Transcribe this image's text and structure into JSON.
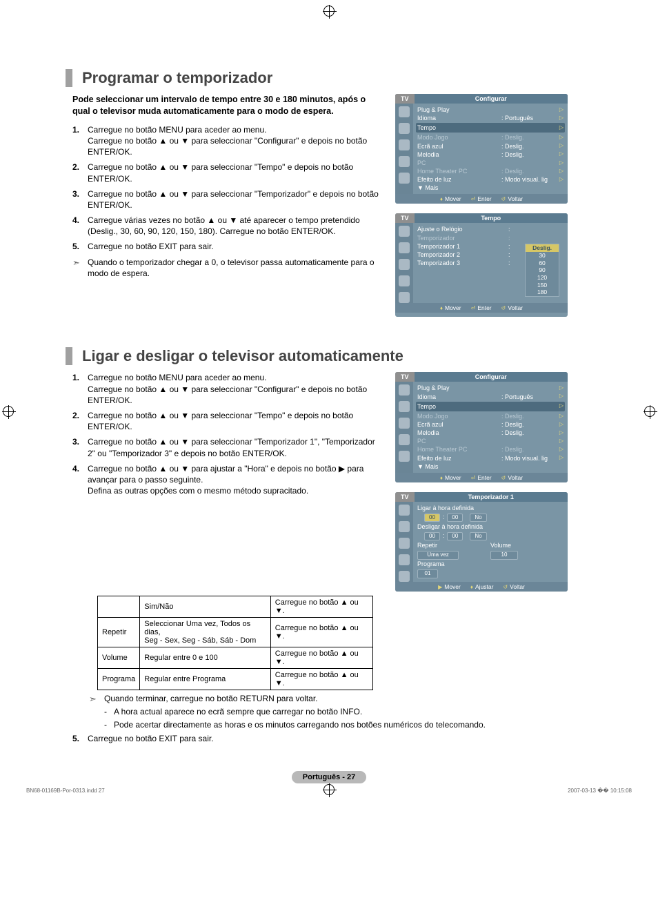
{
  "section1": {
    "title": "Programar o temporizador",
    "intro": "Pode seleccionar um intervalo de tempo entre 30 e 180 minutos, após o qual o televisor muda automaticamente para o modo de espera.",
    "steps": [
      {
        "n": "1.",
        "lines": [
          "Carregue no botão MENU para aceder ao menu.",
          "Carregue no botão ▲ ou ▼ para seleccionar \"Configurar\" e depois no botão ENTER/OK."
        ]
      },
      {
        "n": "2.",
        "lines": [
          "Carregue no botão ▲ ou ▼ para seleccionar \"Tempo\" e depois no botão ENTER/OK."
        ]
      },
      {
        "n": "3.",
        "lines": [
          "Carregue no botão ▲ ou ▼ para seleccionar \"Temporizador\" e depois no botão ENTER/OK."
        ]
      },
      {
        "n": "4.",
        "lines": [
          "Carregue várias vezes no botão ▲ ou ▼ até aparecer o tempo pretendido (Deslig., 30, 60, 90, 120, 150, 180). Carregue no botão ENTER/OK."
        ]
      },
      {
        "n": "5.",
        "lines": [
          "Carregue no botão EXIT para sair."
        ]
      }
    ],
    "note": "Quando o temporizador chegar a 0, o televisor passa automaticamente para o modo de espera."
  },
  "section2": {
    "title": "Ligar e desligar o televisor automaticamente",
    "steps": [
      {
        "n": "1.",
        "lines": [
          "Carregue no botão MENU para aceder ao menu.",
          "Carregue no botão ▲ ou ▼ para seleccionar \"Configurar\" e depois no botão ENTER/OK."
        ]
      },
      {
        "n": "2.",
        "lines": [
          "Carregue no botão ▲ ou ▼ para seleccionar \"Tempo\" e depois no botão ENTER/OK."
        ]
      },
      {
        "n": "3.",
        "lines": [
          "Carregue no botão ▲ ou ▼ para seleccionar \"Temporizador 1\", \"Temporizador 2\" ou \"Temporizador 3\" e depois no botão ENTER/OK."
        ]
      },
      {
        "n": "4.",
        "lines": [
          "Carregue no botão ▲ ou ▼ para ajustar a \"Hora\" e depois no botão ▶ para avançar para o passo seguinte.",
          "Defina as outras opções com o mesmo método supracitado."
        ]
      }
    ],
    "table": {
      "rows": [
        [
          "",
          "Sim/Não",
          "Carregue no botão ▲ ou ▼."
        ],
        [
          "Repetir",
          "Seleccionar Uma vez, Todos os dias,\nSeg - Sex, Seg - Sáb, Sáb - Dom",
          "Carregue no botão ▲ ou ▼."
        ],
        [
          "Volume",
          "Regular entre 0 e 100",
          "Carregue no botão ▲ ou ▼."
        ],
        [
          "Programa",
          "Regular entre Programa",
          "Carregue no botão ▲ ou ▼."
        ]
      ]
    },
    "post_note": "Quando terminar, carregue no botão RETURN para voltar.",
    "post_dashes": [
      "A hora actual aparece no ecrã sempre que carregar no botão INFO.",
      "Pode acertar directamente as horas e os minutos carregando nos botões numéricos do telecomando."
    ],
    "step5": {
      "n": "5.",
      "lines": [
        "Carregue no botão EXIT para sair."
      ]
    }
  },
  "osd_config": {
    "tab": "TV",
    "title": "Configurar",
    "rows": [
      {
        "label": "Plug & Play",
        "value": "",
        "arrow": true
      },
      {
        "label": "Idioma",
        "value": ": Português",
        "arrow": true
      },
      {
        "label": "Tempo",
        "value": "",
        "arrow": true,
        "hl": true
      },
      {
        "label": "Modo Jogo",
        "value": ": Deslig.",
        "dim": true,
        "arrow": true
      },
      {
        "label": "Ecrã azul",
        "value": ": Deslig.",
        "arrow": true
      },
      {
        "label": "Melodia",
        "value": ": Deslig.",
        "arrow": true
      },
      {
        "label": "PC",
        "value": "",
        "dim": true,
        "arrow": true
      },
      {
        "label": "Home Theater PC",
        "value": ": Deslig.",
        "dim": true,
        "arrow": true
      },
      {
        "label": "Efeito de luz",
        "value": ": Modo visual. lig",
        "arrow": true
      },
      {
        "label": "▼ Mais",
        "value": "",
        "arrow": false
      }
    ],
    "footer": [
      "Mover",
      "Enter",
      "Voltar"
    ]
  },
  "osd_tempo": {
    "tab": "TV",
    "title": "Tempo",
    "rows": [
      {
        "label": "Ajuste o Relógio",
        "value": ":"
      },
      {
        "label": "Temporizador",
        "value": ":",
        "hl": true
      },
      {
        "label": "Temporizador 1",
        "value": ":"
      },
      {
        "label": "Temporizador 2",
        "value": ":"
      },
      {
        "label": "Temporizador 3",
        "value": ":"
      }
    ],
    "submenu": [
      "Deslig.",
      "30",
      "60",
      "90",
      "120",
      "150",
      "180"
    ],
    "footer": [
      "Mover",
      "Enter",
      "Voltar"
    ]
  },
  "osd_timer1": {
    "tab": "TV",
    "title": "Temporizador 1",
    "on_label": "Ligar à hora definida",
    "off_label": "Desligar à hora definida",
    "hh": "00",
    "mm": "00",
    "no_val": "No",
    "repeat_label": "Repetir",
    "repeat_val": "Uma vez",
    "volume_label": "Volume",
    "volume_val": "10",
    "prog_label": "Programa",
    "prog_val": "01",
    "footer": [
      "Mover",
      "Ajustar",
      "Voltar"
    ]
  },
  "page_number": "Português - 27",
  "print_footer_left": "BN68-01169B-Por-0313.indd   27",
  "print_footer_right": "2007-03-13   �� 10:15:08"
}
